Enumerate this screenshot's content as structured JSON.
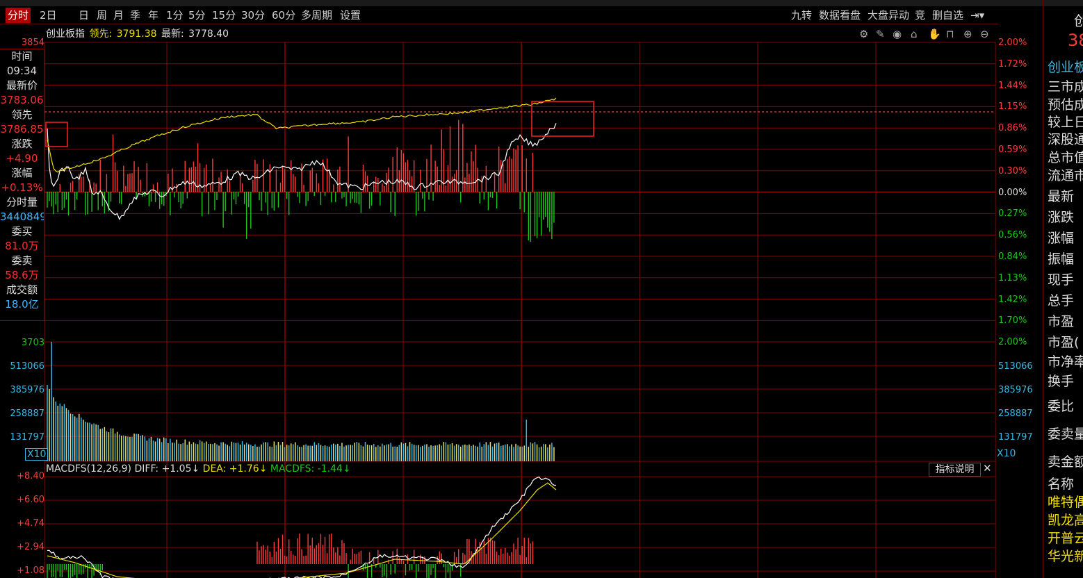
{
  "toolbar": {
    "items": [
      "分时",
      "2日",
      "日",
      "周",
      "月",
      "季",
      "年",
      "1分",
      "5分",
      "15分",
      "30分",
      "60分",
      "多周期",
      "设置"
    ],
    "active": "分时",
    "right_items": [
      "九转",
      "数据看盘",
      "大盘异动",
      "竞",
      "删自选"
    ]
  },
  "header": {
    "name": "创业板指",
    "lead_label": "领先:",
    "lead_value": "3791.38",
    "latest_label": "最新:",
    "latest_value": "3778.40"
  },
  "left_panel": {
    "top_value": "3854",
    "rows": [
      {
        "label": "时间",
        "value": "09:34"
      },
      {
        "label": "最新价",
        "value": "3783.06"
      },
      {
        "label": "领先",
        "value": "3786.85"
      },
      {
        "label": "涨跌",
        "value": "+4.90"
      },
      {
        "label": "涨幅",
        "value": "+0.13%"
      },
      {
        "label": "分时量",
        "value": "3440849"
      },
      {
        "label": "委买",
        "value": "81.0万"
      },
      {
        "label": "委卖",
        "value": "58.6万"
      },
      {
        "label": "成交额",
        "value": "18.0亿"
      }
    ]
  },
  "price_axis_right": [
    "2.00%",
    "1.72%",
    "1.44%",
    "1.15%",
    "0.86%",
    "0.59%",
    "0.30%",
    "0.00%",
    "0.27%",
    "0.56%",
    "0.84%",
    "1.13%",
    "1.42%",
    "1.70%",
    "2.00%"
  ],
  "volume_axis": [
    "3703",
    "513066",
    "385976",
    "258887",
    "131797"
  ],
  "volume_axis_right": [
    "513066",
    "385976",
    "258887",
    "131797"
  ],
  "volume_multiplier": "X10",
  "macd": {
    "title": "MACDFS(12,26,9)",
    "diff": "DIFF: +1.05↓",
    "dea": "DEA: +1.76↓",
    "macdfs": "MACDFS: -1.44↓",
    "button": "指标说明",
    "axis": [
      "+8.40",
      "+6.60",
      "+4.74",
      "+2.94",
      "+1.08"
    ]
  },
  "right_panel": {
    "top_glyph": "创",
    "value": "38",
    "title": "创业板",
    "rows": [
      "三市成",
      "预估成",
      "较上日",
      "深股通",
      "总市值",
      "流通市",
      "最新",
      "涨跌",
      "涨幅",
      "振幅",
      "现手",
      "总手",
      "市盈",
      "市盈(",
      "市净率",
      "换手",
      "委比",
      "委卖量",
      "卖金额",
      "名称",
      "唯特偶",
      "凯龙高",
      "开普云",
      "华光新"
    ]
  },
  "colors": {
    "up": "#ff3b3b",
    "down": "#19c819",
    "price_line": "#ffffff",
    "avg_line": "#f0e000",
    "volume": "#38b8e8",
    "grid": "#8a0000"
  },
  "chart_data": {
    "type": "line",
    "series": [],
    "ylim_pct": [
      -2.0,
      2.0
    ]
  }
}
